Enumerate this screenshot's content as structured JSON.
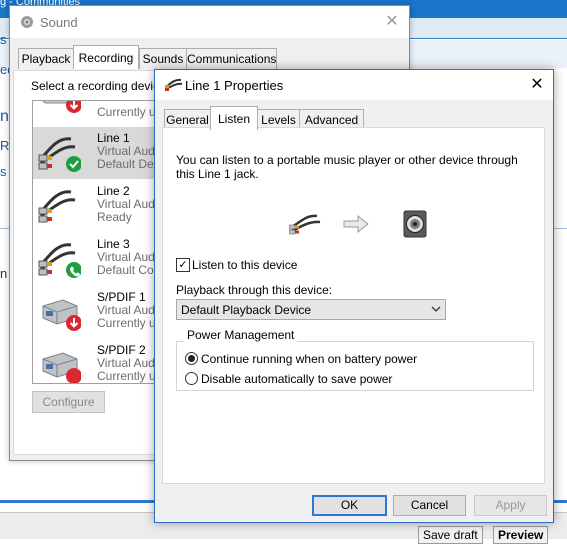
{
  "background": {
    "title_fragment": "g - Communities",
    "side_text_1": "s l",
    "side_text_2": "ed",
    "side_text_3": "n",
    "side_text_4": "RE",
    "side_text_5": "s",
    "side_text_6": "n a",
    "save_draft_label": "Save draft",
    "preview_label": "Preview"
  },
  "sound_dialog": {
    "title": "Sound",
    "tabs": [
      {
        "label": "Playback"
      },
      {
        "label": "Recording"
      },
      {
        "label": "Sounds"
      },
      {
        "label": "Communications"
      }
    ],
    "instruction": "Select a recording device",
    "devices": [
      {
        "name": "",
        "line1": "Currently u",
        "line2": "",
        "status": "down"
      },
      {
        "name": "Line 1",
        "line1": "Virtual Aud",
        "line2": "Default Dev",
        "status": "default"
      },
      {
        "name": "Line 2",
        "line1": "Virtual Aud",
        "line2": "Ready",
        "status": "none"
      },
      {
        "name": "Line 3",
        "line1": "Virtual Aud",
        "line2": "Default Co",
        "status": "comm"
      },
      {
        "name": "S/PDIF 1",
        "line1": "Virtual Aud",
        "line2": "Currently u",
        "status": "down"
      },
      {
        "name": "S/PDIF 2",
        "line1": "Virtual Aud",
        "line2": "Currently u",
        "status": "down"
      }
    ],
    "configure_label": "Configure"
  },
  "properties_dialog": {
    "title": "Line 1 Properties",
    "tabs": [
      {
        "label": "General"
      },
      {
        "label": "Listen"
      },
      {
        "label": "Levels"
      },
      {
        "label": "Advanced"
      }
    ],
    "description": "You can listen to a portable music player or other device through this Line 1 jack.",
    "listen_checkbox_label": "Listen to this device",
    "listen_checked": true,
    "playback_label": "Playback through this device:",
    "playback_value": "Default Playback Device",
    "power_group_label": "Power Management",
    "power_options": [
      {
        "label": "Continue running when on battery power",
        "selected": true
      },
      {
        "label": "Disable automatically to save power",
        "selected": false
      }
    ],
    "ok_label": "OK",
    "cancel_label": "Cancel",
    "apply_label": "Apply"
  },
  "colors": {
    "accent": "#2e78d0",
    "selection": "#d9d9d9",
    "default_badge": "#1e9e3e",
    "warning_badge": "#d9282f"
  }
}
